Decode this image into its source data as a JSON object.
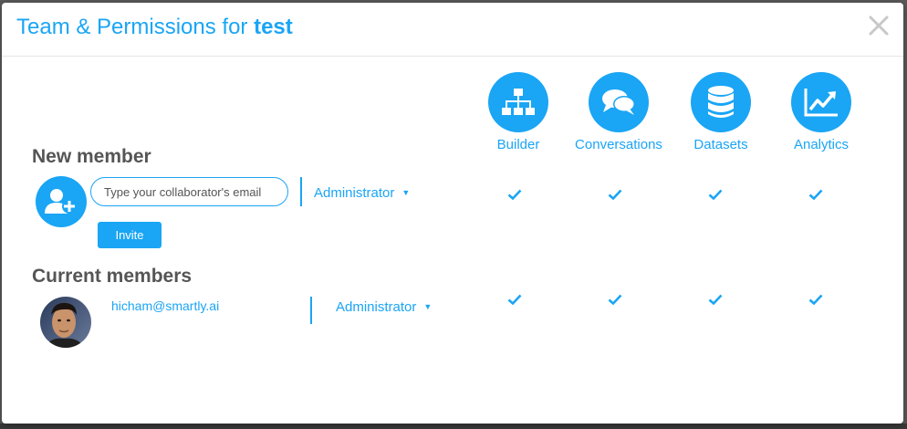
{
  "modal": {
    "title_prefix": "Team & Permissions for ",
    "title_project": "test",
    "close_icon": "close-icon"
  },
  "permissions": [
    {
      "label": "Builder",
      "icon": "sitemap-icon"
    },
    {
      "label": "Conversations",
      "icon": "chat-bubbles-icon"
    },
    {
      "label": "Datasets",
      "icon": "database-icon"
    },
    {
      "label": "Analytics",
      "icon": "line-chart-icon"
    }
  ],
  "new_member": {
    "heading": "New member",
    "email_placeholder": "Type your collaborator's email",
    "email_value": "",
    "role": "Administrator",
    "invite_label": "Invite",
    "permissions_checked": [
      true,
      true,
      true,
      true
    ]
  },
  "current_members": {
    "heading": "Current members",
    "members": [
      {
        "email": "hicham@smartly.ai",
        "role": "Administrator",
        "permissions_checked": [
          true,
          true,
          true,
          true
        ]
      }
    ]
  },
  "colors": {
    "accent": "#1aa5f5",
    "heading": "#555555"
  }
}
